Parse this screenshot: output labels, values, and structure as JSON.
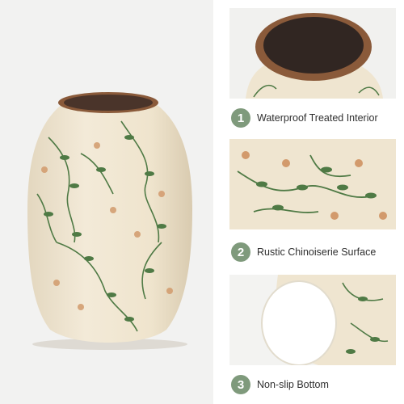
{
  "product": {
    "main_image_icon": "floral-ceramic-vase-icon",
    "colors": {
      "badge": "#7f9a7c",
      "glaze_cream": "#efe5d0",
      "rim_brown": "#8a5a3a",
      "leaf_green": "#4f7a45",
      "blossom_orange": "#d29a6c"
    }
  },
  "features": [
    {
      "number": "1",
      "label": "Waterproof Treated Interior",
      "icon": "vase-opening-closeup-icon"
    },
    {
      "number": "2",
      "label": "Rustic Chinoiserie Surface",
      "icon": "floral-surface-closeup-icon"
    },
    {
      "number": "3",
      "label": "Non-slip Bottom",
      "icon": "vase-bottom-closeup-icon"
    }
  ]
}
